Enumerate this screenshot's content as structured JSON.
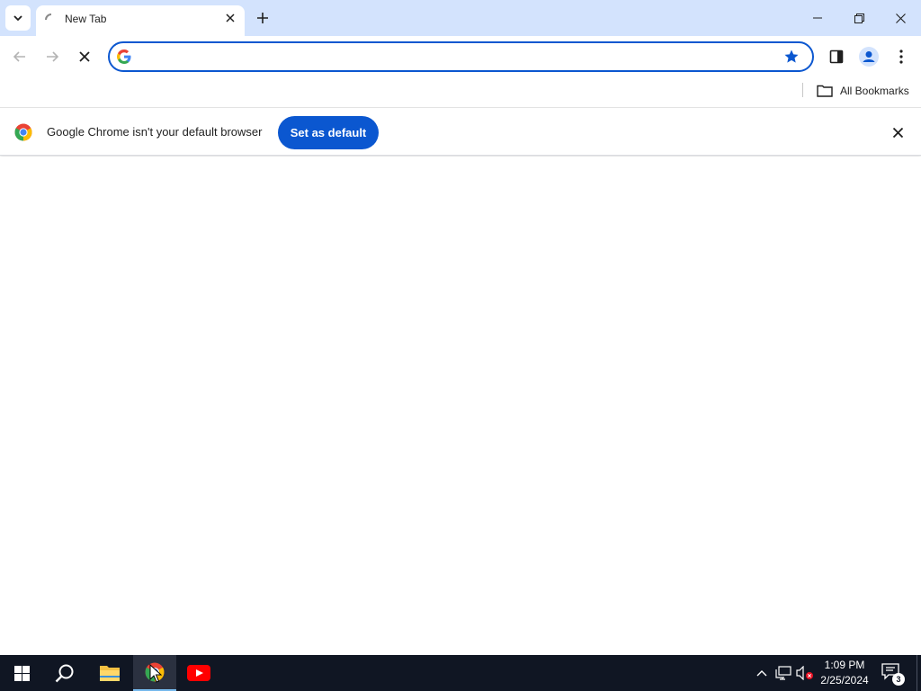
{
  "tabs": [
    {
      "title": "New Tab",
      "loading": true
    }
  ],
  "omnibox": {
    "value": "",
    "placeholder": ""
  },
  "bookmarks_bar": {
    "all_bookmarks_label": "All Bookmarks"
  },
  "infobar": {
    "message": "Google Chrome isn't your default browser",
    "button_label": "Set as default"
  },
  "taskbar": {
    "apps": [
      "start-icon",
      "search-icon",
      "file-explorer-icon",
      "chrome-icon",
      "youtube-icon"
    ],
    "clock": {
      "time": "1:09 PM",
      "date": "2/25/2024"
    },
    "notification_count": "3"
  },
  "colors": {
    "tabstrip_bg": "#d3e3fd",
    "accent": "#0b57d0",
    "taskbar_bg": "#101623"
  }
}
